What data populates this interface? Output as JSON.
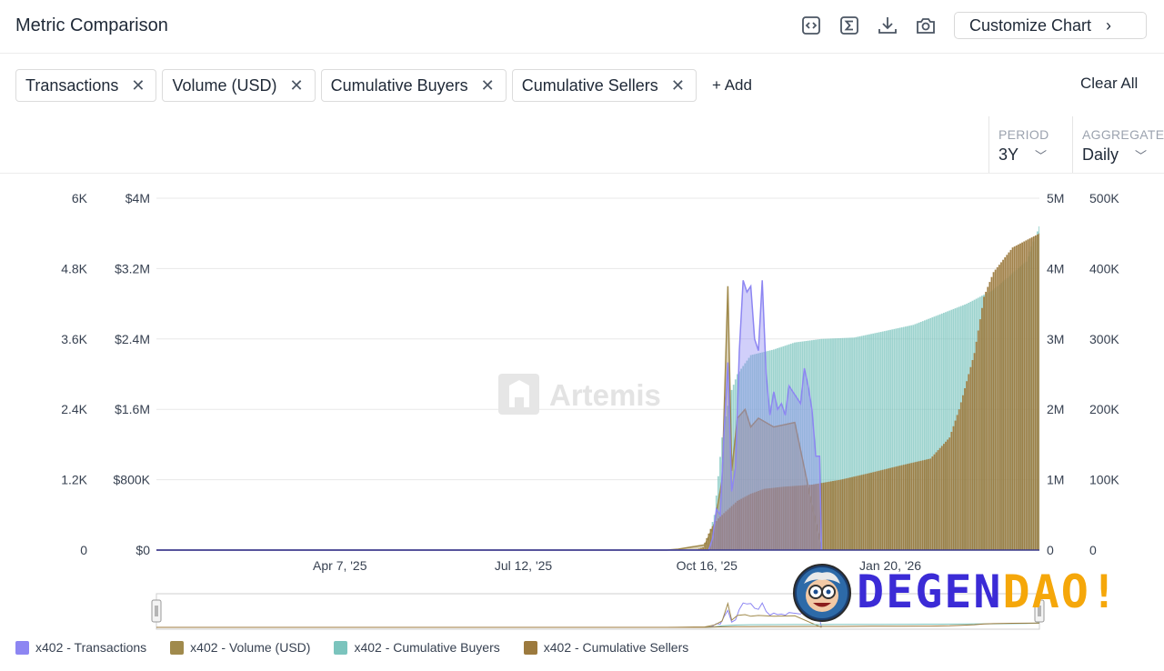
{
  "header": {
    "title": "Metric Comparison",
    "customize_label": "Customize Chart",
    "tools": [
      "embed-code-icon",
      "sigma-icon",
      "download-icon",
      "camera-icon"
    ]
  },
  "filters": {
    "chips": [
      "Transactions",
      "Volume (USD)",
      "Cumulative Buyers",
      "Cumulative Sellers"
    ],
    "add_label": "+ Add",
    "clear_label": "Clear All"
  },
  "controls": {
    "period_label": "PERIOD",
    "period_value": "3Y",
    "aggregate_label": "AGGREGATE",
    "aggregate_value": "Daily"
  },
  "watermark": "Artemis",
  "logo_text": {
    "part1": "DEGEN",
    "part2": "DAO!"
  },
  "chart_data": {
    "type": "area",
    "x_start": "2025-01-01",
    "x_end": "2026-04-08",
    "x_ticks": [
      "Apr 7, '25",
      "Jul 12, '25",
      "Oct 16, '25",
      "Jan 20, '26"
    ],
    "grid": true,
    "axes": {
      "transactions": {
        "ticks": [
          "0",
          "1.2K",
          "2.4K",
          "3.6K",
          "4.8K",
          "6K"
        ],
        "range": [
          0,
          6000
        ]
      },
      "volume": {
        "ticks": [
          "$0",
          "$800K",
          "$1.6M",
          "$2.4M",
          "$3.2M",
          "$4M"
        ],
        "range": [
          0,
          4000000
        ]
      },
      "buyers": {
        "ticks": [
          "0",
          "1M",
          "2M",
          "3M",
          "4M",
          "5M"
        ],
        "range": [
          0,
          5000000
        ]
      },
      "sellers": {
        "ticks": [
          "0",
          "100K",
          "200K",
          "300K",
          "400K",
          "500K"
        ],
        "range": [
          0,
          500000
        ]
      }
    },
    "series": [
      {
        "name": "x402 - Transactions",
        "axis": "transactions",
        "color": "#8d86f2",
        "points": [
          [
            "2025-01-01",
            0
          ],
          [
            "2025-10-17",
            0
          ],
          [
            "2025-10-19",
            200
          ],
          [
            "2025-10-21",
            700
          ],
          [
            "2025-10-23",
            600
          ],
          [
            "2025-10-25",
            2000
          ],
          [
            "2025-10-27",
            3200
          ],
          [
            "2025-10-29",
            1000
          ],
          [
            "2025-10-31",
            1400
          ],
          [
            "2025-11-02",
            3400
          ],
          [
            "2025-11-04",
            4600
          ],
          [
            "2025-11-06",
            4400
          ],
          [
            "2025-11-08",
            4500
          ],
          [
            "2025-11-10",
            3600
          ],
          [
            "2025-11-12",
            3400
          ],
          [
            "2025-11-14",
            4600
          ],
          [
            "2025-11-16",
            3000
          ],
          [
            "2025-11-18",
            2300
          ],
          [
            "2025-11-20",
            2700
          ],
          [
            "2025-11-22",
            2400
          ],
          [
            "2025-11-24",
            2500
          ],
          [
            "2025-11-26",
            2300
          ],
          [
            "2025-11-28",
            2800
          ],
          [
            "2025-11-30",
            2700
          ],
          [
            "2025-12-02",
            2600
          ],
          [
            "2025-12-04",
            2500
          ],
          [
            "2025-12-06",
            3100
          ],
          [
            "2025-12-08",
            2800
          ],
          [
            "2025-12-10",
            2400
          ],
          [
            "2025-12-12",
            1600
          ],
          [
            "2025-12-14",
            1600
          ],
          [
            "2025-12-15",
            0
          ]
        ]
      },
      {
        "name": "x402 - Volume (USD)",
        "axis": "volume",
        "color": "#a08a4c",
        "points": [
          [
            "2025-01-01",
            0
          ],
          [
            "2025-09-25",
            0
          ],
          [
            "2025-10-01",
            10000
          ],
          [
            "2025-10-15",
            60000
          ],
          [
            "2025-10-20",
            300000
          ],
          [
            "2025-10-24",
            800000
          ],
          [
            "2025-10-27",
            3000000
          ],
          [
            "2025-10-29",
            900000
          ],
          [
            "2025-11-01",
            1500000
          ],
          [
            "2025-11-05",
            1600000
          ],
          [
            "2025-11-08",
            1400000
          ],
          [
            "2025-11-12",
            1500000
          ],
          [
            "2025-11-20",
            1400000
          ],
          [
            "2025-12-01",
            1450000
          ],
          [
            "2025-12-15",
            0
          ]
        ]
      },
      {
        "name": "x402 - Cumulative Buyers",
        "axis": "buyers",
        "color": "#7bc4bd",
        "points": [
          [
            "2025-01-01",
            0
          ],
          [
            "2025-10-15",
            0
          ],
          [
            "2025-10-20",
            500000
          ],
          [
            "2025-10-24",
            1600000
          ],
          [
            "2025-10-28",
            2200000
          ],
          [
            "2025-11-01",
            2500000
          ],
          [
            "2025-11-08",
            2770000
          ],
          [
            "2025-11-20",
            2850000
          ],
          [
            "2025-12-01",
            2950000
          ],
          [
            "2025-12-15",
            3000000
          ],
          [
            "2026-01-01",
            3020000
          ],
          [
            "2026-01-15",
            3100000
          ],
          [
            "2026-02-01",
            3200000
          ],
          [
            "2026-02-15",
            3350000
          ],
          [
            "2026-03-01",
            3500000
          ],
          [
            "2026-03-15",
            3700000
          ],
          [
            "2026-04-01",
            4100000
          ],
          [
            "2026-04-08",
            4600000
          ]
        ]
      },
      {
        "name": "x402 - Cumulative Sellers",
        "axis": "sellers",
        "color": "#9c7a3e",
        "points": [
          [
            "2025-01-01",
            0
          ],
          [
            "2025-10-10",
            0
          ],
          [
            "2025-10-14",
            4000
          ],
          [
            "2025-10-18",
            30000
          ],
          [
            "2025-10-22",
            45000
          ],
          [
            "2025-10-26",
            55000
          ],
          [
            "2025-11-01",
            70000
          ],
          [
            "2025-11-08",
            80000
          ],
          [
            "2025-11-15",
            87000
          ],
          [
            "2025-11-25",
            90000
          ],
          [
            "2025-12-10",
            93000
          ],
          [
            "2025-12-25",
            100000
          ],
          [
            "2026-01-10",
            110000
          ],
          [
            "2026-01-25",
            120000
          ],
          [
            "2026-02-10",
            130000
          ],
          [
            "2026-02-20",
            160000
          ],
          [
            "2026-02-25",
            200000
          ],
          [
            "2026-03-05",
            280000
          ],
          [
            "2026-03-10",
            360000
          ],
          [
            "2026-03-15",
            395000
          ],
          [
            "2026-03-25",
            430000
          ],
          [
            "2026-04-08",
            450000
          ]
        ]
      }
    ]
  }
}
